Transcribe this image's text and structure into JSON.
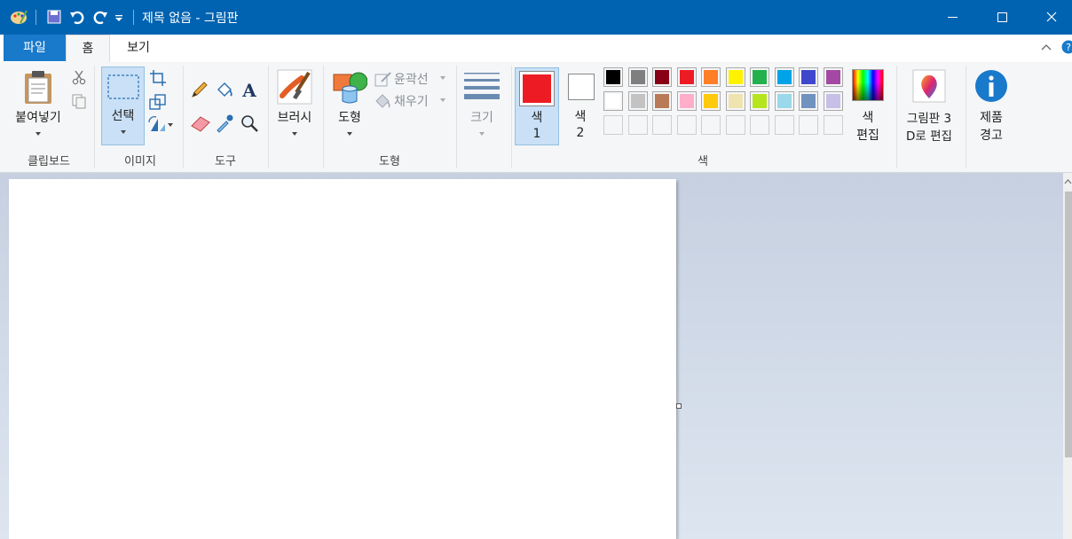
{
  "window": {
    "title": "제목 없음 - 그림판"
  },
  "tabs": {
    "file": "파일",
    "home": "홈",
    "view": "보기"
  },
  "clipboard": {
    "paste": "붙여넣기",
    "group": "클립보드"
  },
  "image": {
    "select": "선택",
    "group": "이미지"
  },
  "tools": {
    "group": "도구",
    "text_glyph": "A"
  },
  "brushes": {
    "label": "브러시"
  },
  "shapes": {
    "label": "도형",
    "outline": "윤곽선",
    "fill": "채우기",
    "group": "도형"
  },
  "size": {
    "label": "크기"
  },
  "colors": {
    "color1_label": "색",
    "color1_num": "1",
    "color2_label": "색",
    "color2_num": "2",
    "color1": "#ed1c24",
    "color2": "#ffffff",
    "edit_line1": "색",
    "edit_line2": "편집",
    "group": "색",
    "palette_row1": [
      "#000000",
      "#7f7f7f",
      "#880015",
      "#ed1c24",
      "#ff7f27",
      "#fff200",
      "#22b14c",
      "#00a2e8",
      "#3f48cc",
      "#a349a4"
    ],
    "palette_row2": [
      "#ffffff",
      "#c3c3c3",
      "#b97a57",
      "#ffaec9",
      "#ffc90e",
      "#efe4b0",
      "#b5e61d",
      "#99d9ea",
      "#7092be",
      "#c8bfe7"
    ]
  },
  "paint3d": {
    "line1": "그림판 3",
    "line2": "D로 편집"
  },
  "product": {
    "line1": "제품",
    "line2": "경고"
  },
  "accent": "#0063b1"
}
